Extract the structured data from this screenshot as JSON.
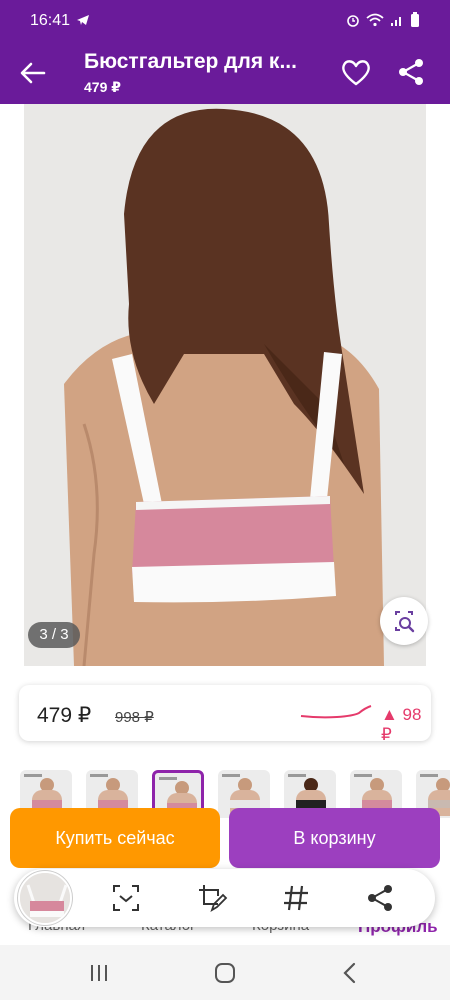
{
  "status_bar": {
    "time": "16:41"
  },
  "app_bar": {
    "title": "Бюстгальтер для к...",
    "price": "479 ₽"
  },
  "photo": {
    "counter": "3 / 3"
  },
  "price_card": {
    "current": "479 ₽",
    "old": "998 ₽",
    "delta": "▲ 98 ₽"
  },
  "buttons": {
    "buy_now": "Купить сейчас",
    "add_to_cart": "В корзину"
  },
  "bottom_nav": {
    "home": "Главная",
    "catalog": "Каталог",
    "cart": "Корзина",
    "profile": "Профиль"
  },
  "colors": {
    "brand": "#6a1b9a",
    "buy": "#ff9800",
    "cart": "#9c3fbf",
    "delta": "#e53a6b"
  },
  "icons": [
    "back-arrow-icon",
    "heart-icon",
    "share-icon",
    "lens-search-icon",
    "scan-icon",
    "edit-crop-icon",
    "hash-icon",
    "share-icon"
  ]
}
